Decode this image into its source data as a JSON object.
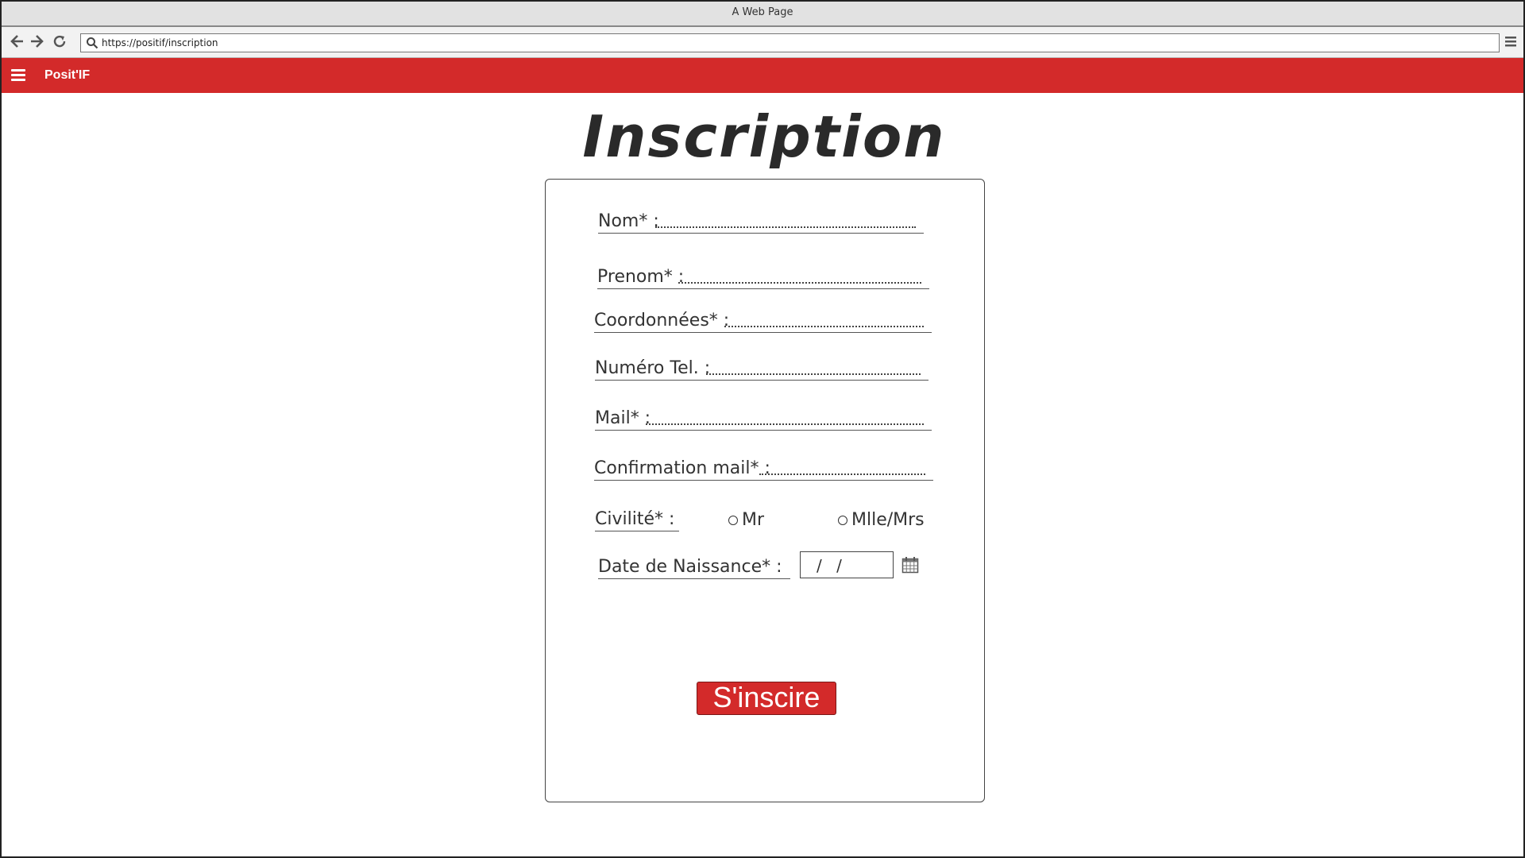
{
  "window": {
    "title": "A Web Page"
  },
  "browser": {
    "url": "https://positif/inscription"
  },
  "header": {
    "brand": "Posit'IF"
  },
  "page": {
    "title": "Inscription"
  },
  "form": {
    "fields": [
      {
        "label": "Nom* :"
      },
      {
        "label": "Prenom* :"
      },
      {
        "label": "Coordonnées* :"
      },
      {
        "label": "Numéro Tel. :"
      },
      {
        "label": "Mail* :"
      },
      {
        "label": "Confirmation mail* :"
      }
    ],
    "civility": {
      "label": "Civilité* :",
      "options": [
        "Mr",
        "Mlle/Mrs"
      ]
    },
    "birthdate": {
      "label": "Date de Naissance* :",
      "value": "/ /"
    },
    "submit_label": "S'inscire"
  }
}
